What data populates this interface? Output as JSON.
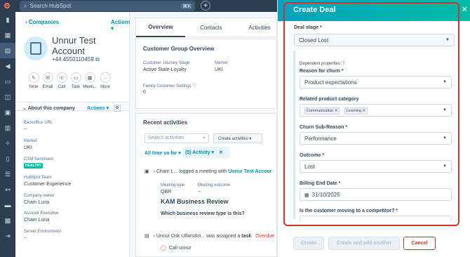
{
  "topbar": {
    "search_placeholder": "Search HubSpot",
    "shortcut": "⌘K"
  },
  "record": {
    "back_label": "Companies",
    "actions_label": "Actions",
    "name": "Unnur Test Account",
    "phone": "+44 4550110459",
    "quick_actions": [
      "Note",
      "Email",
      "Call",
      "Task",
      "Meeti...",
      "More"
    ]
  },
  "about": {
    "title": "About this company",
    "actions_label": "Actions",
    "properties": [
      {
        "label": "Backoffice URL",
        "value": "--"
      },
      {
        "label": "Market",
        "value": "UKI"
      },
      {
        "label": "CSM Sentiment",
        "value": "HEALTHY"
      },
      {
        "label": "HubSpot Team",
        "value": "Customer Experience"
      },
      {
        "label": "Company owner",
        "value": "Cham Luna"
      },
      {
        "label": "Account Executive",
        "value": "Cham Luna"
      },
      {
        "label": "Server Environment",
        "value": "--"
      }
    ]
  },
  "tabs": [
    "Overview",
    "Contacts",
    "Activities"
  ],
  "overview": {
    "title": "Customer Group Overview",
    "journey_label": "Customer Journey Stage",
    "journey_value": "Active State-Loyalty",
    "market_label": "Market",
    "market_value": "UKI",
    "family_label": "Family Customer Settings",
    "family_value": "0"
  },
  "recent": {
    "title": "Recent activities",
    "search_placeholder": "Search activities",
    "create_label": "Create activities",
    "filter_time": "All time so far",
    "filter_activity": "(5) Activity",
    "item1_actor": "Cham L...",
    "item1_text": "logged a meeting with",
    "item1_target": "Unnur Test Accour",
    "meeting_type_label": "Meeting type",
    "meeting_type_value": "QBR",
    "meeting_outcome_label": "Meeting outcome",
    "meeting_outcome_value": "--",
    "meeting_title": "KAM Business Review",
    "meeting_question": "Which business review type is this?",
    "item2_actor": "Unnur Osk Ulfarsdot...",
    "item2_text": "was assigned a",
    "item2_kind": "task",
    "item2_status": "Overdue",
    "task_title": "Call unnur"
  },
  "deal": {
    "title": "Create Deal",
    "stage_label": "Deal stage *",
    "stage_value": "Closed Lost",
    "dependent_label": "Dependent properties",
    "reason_label": "Reason for churn *",
    "reason_value": "Product expectations",
    "category_label": "Related product category",
    "category_tags": [
      "Communication",
      "Learning"
    ],
    "subreason_label": "Churn Sub-Reason *",
    "subreason_value": "Performance",
    "outcome_label": "Outcome *",
    "outcome_value": "Lost",
    "billing_label": "Billing End Date *",
    "billing_value": "31/10/2025",
    "competitor_label": "Is the customer moving to a competitor? *",
    "create_label": "Create",
    "create_add_label": "Create and add another",
    "cancel_label": "Cancel"
  },
  "colors": {
    "accent": "#00a4bd",
    "highlight": "#d0332f",
    "link": "#0091ae",
    "nav": "#2d3e50"
  }
}
